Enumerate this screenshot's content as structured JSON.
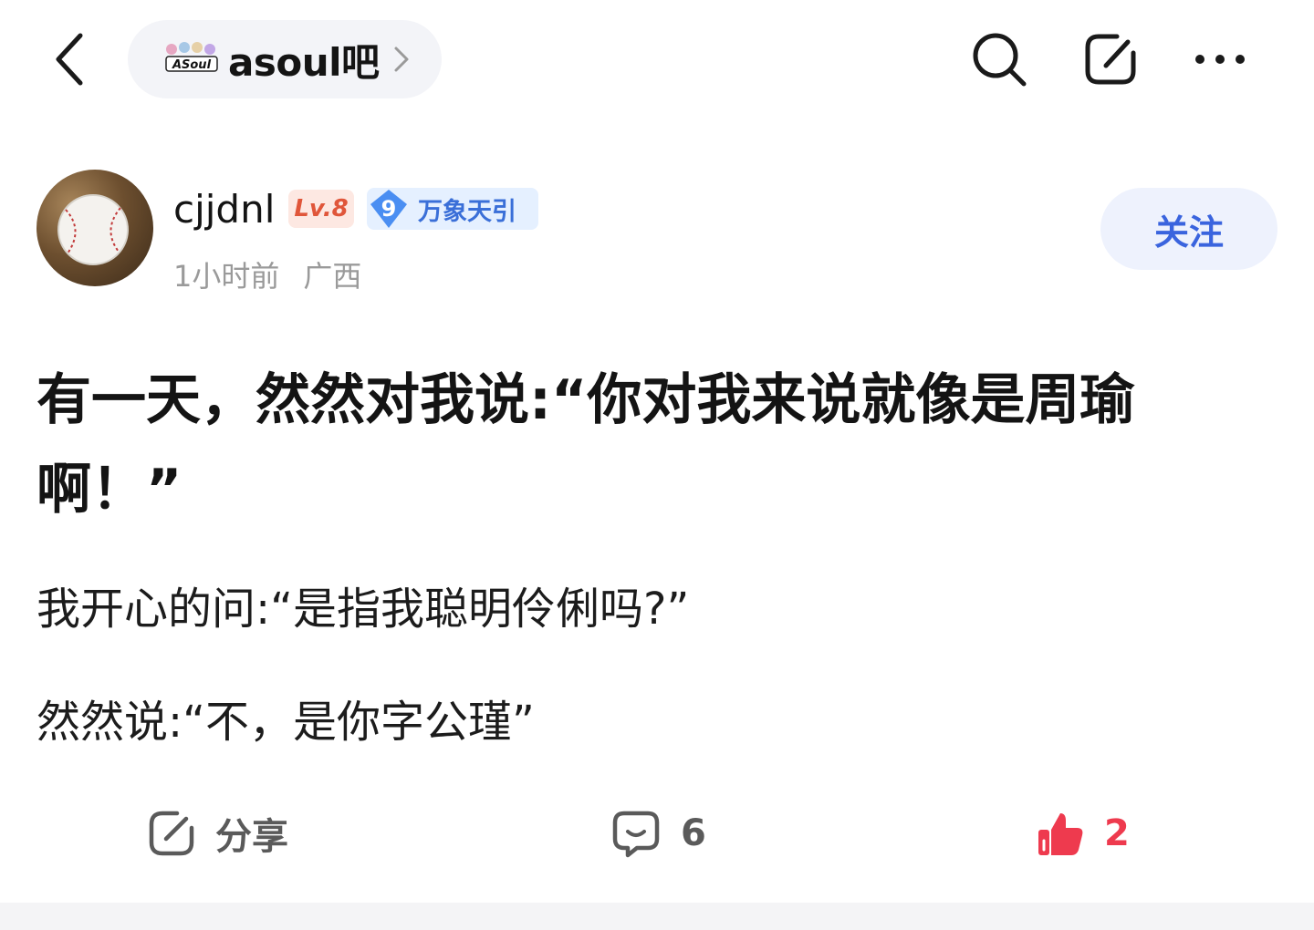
{
  "header": {
    "forum_name": "asoul吧",
    "forum_logo_text": "ASoul"
  },
  "author": {
    "username": "cjjdnl",
    "level": "Lv.8",
    "title_number": "9",
    "title_name": "万象天引",
    "time": "1小时前",
    "location": "广西",
    "follow_label": "关注"
  },
  "post": {
    "title": "有一天，然然对我说:“你对我来说就像是周瑜啊！”",
    "lines": [
      "我开心的问:“是指我聪明伶俐吗?”",
      "然然说:“不，是你字公瑾”"
    ]
  },
  "actions": {
    "share_label": "分享",
    "comment_count": "6",
    "like_count": "2"
  },
  "colors": {
    "accent_blue": "#3a64de",
    "like_red": "#ee3a4e",
    "level_red": "#e0563a",
    "meta_gray": "#9a9a9a"
  }
}
